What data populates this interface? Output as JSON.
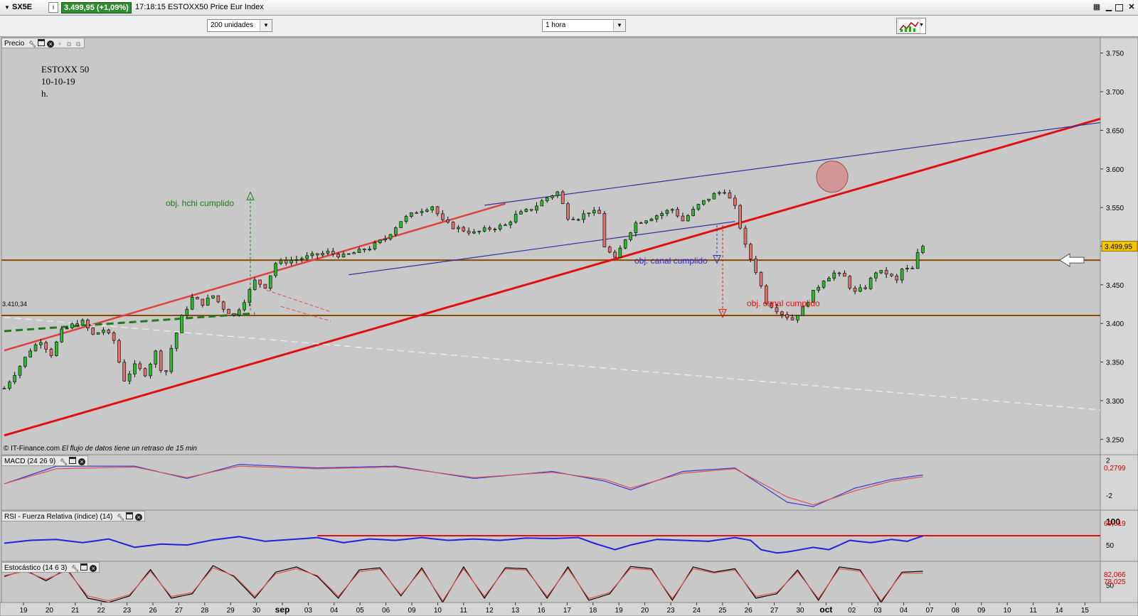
{
  "window": {
    "symbol": "SX5E",
    "info_icon": "info-icon",
    "price_badge": "3.499,95 (+1,09%)",
    "time_title": "17:18:15 ESTOXX50 Price Eur Index"
  },
  "toolbar": {
    "units_select": "200 unidades",
    "interval_select": "1 hora"
  },
  "panels": {
    "price_label": "Precio",
    "macd_label": "MACD (24 26 9)",
    "rsi_label": "RSI - Fuerza Relativa (índice) (14)",
    "stoch_label": "Estocástico (14 6 3)"
  },
  "annotations": {
    "title_line1": "ESTOXX 50",
    "title_line2": "10-10-19",
    "title_line3": "h.",
    "hchi": "obj. hchi cumplido",
    "canal_blue": "obj. canal cumplido",
    "canal_red": "obj. canal cumplido",
    "level_label": "3.410,34",
    "credit_1": "© IT-Finance.com",
    "credit_2": "El flujo de datos tiene un retraso de 15 min"
  },
  "chart_data": [
    {
      "type": "candlestick",
      "title": "",
      "y_ticks": [
        "3.750",
        "3.700",
        "3.650",
        "3.600",
        "3.550",
        "3.500",
        "3.450",
        "3.400",
        "3.350",
        "3.300",
        "3.250"
      ],
      "ylim": [
        3230,
        3770
      ],
      "current_value": "3.499,95",
      "horizontal_levels": [
        3410.34,
        3482
      ],
      "x_ticks": [
        "19",
        "20",
        "21",
        "22",
        "23",
        "26",
        "27",
        "28",
        "29",
        "30",
        "sep",
        "03",
        "04",
        "05",
        "06",
        "09",
        "10",
        "11",
        "12",
        "13",
        "16",
        "17",
        "18",
        "19",
        "20",
        "23",
        "24",
        "25",
        "26",
        "27",
        "30",
        "oct",
        "02",
        "03",
        "04",
        "07",
        "08",
        "09",
        "10",
        "11",
        "14",
        "15"
      ],
      "close_path": [
        [
          0,
          3316
        ],
        [
          3,
          3345
        ],
        [
          5,
          3366
        ],
        [
          7,
          3378
        ],
        [
          9,
          3360
        ],
        [
          11,
          3390
        ],
        [
          13,
          3398
        ],
        [
          15,
          3402
        ],
        [
          17,
          3385
        ],
        [
          19,
          3392
        ],
        [
          21,
          3378
        ],
        [
          22,
          3350
        ],
        [
          23,
          3327
        ],
        [
          25,
          3345
        ],
        [
          27,
          3335
        ],
        [
          29,
          3363
        ],
        [
          30,
          3342
        ],
        [
          31,
          3338
        ],
        [
          32,
          3368
        ],
        [
          34,
          3408
        ],
        [
          36,
          3433
        ],
        [
          38,
          3426
        ],
        [
          40,
          3436
        ],
        [
          42,
          3420
        ],
        [
          44,
          3410
        ],
        [
          46,
          3430
        ],
        [
          48,
          3455
        ],
        [
          50,
          3448
        ],
        [
          52,
          3478
        ],
        [
          56,
          3483
        ],
        [
          62,
          3492
        ],
        [
          65,
          3487
        ],
        [
          70,
          3498
        ],
        [
          73,
          3510
        ],
        [
          76,
          3533
        ],
        [
          79,
          3545
        ],
        [
          82,
          3552
        ],
        [
          84,
          3532
        ],
        [
          86,
          3525
        ],
        [
          90,
          3517
        ],
        [
          93,
          3523
        ],
        [
          96,
          3527
        ],
        [
          98,
          3540
        ],
        [
          101,
          3548
        ],
        [
          104,
          3563
        ],
        [
          106,
          3570
        ],
        [
          108,
          3538
        ],
        [
          110,
          3537
        ],
        [
          112,
          3545
        ],
        [
          114,
          3542
        ],
        [
          115,
          3500
        ],
        [
          117,
          3483
        ],
        [
          119,
          3510
        ],
        [
          121,
          3530
        ],
        [
          125,
          3540
        ],
        [
          128,
          3548
        ],
        [
          130,
          3533
        ],
        [
          133,
          3553
        ],
        [
          136,
          3567
        ],
        [
          138,
          3572
        ],
        [
          140,
          3550
        ],
        [
          142,
          3500
        ],
        [
          144,
          3468
        ],
        [
          146,
          3428
        ],
        [
          149,
          3413
        ],
        [
          151,
          3405
        ],
        [
          153,
          3420
        ],
        [
          155,
          3440
        ],
        [
          157,
          3457
        ],
        [
          159,
          3465
        ],
        [
          161,
          3460
        ],
        [
          162,
          3448
        ],
        [
          163,
          3440
        ],
        [
          165,
          3447
        ],
        [
          167,
          3467
        ],
        [
          169,
          3465
        ],
        [
          171,
          3455
        ],
        [
          172,
          3470
        ],
        [
          174,
          3470
        ],
        [
          175,
          3490
        ],
        [
          176,
          3500
        ]
      ]
    },
    {
      "type": "line",
      "title": "",
      "y_ticks": [
        "2",
        "-2"
      ],
      "ylim": [
        -3.7,
        2.6
      ],
      "current_value": "0,2799",
      "series": [
        {
          "values": [
            [
              0,
              -0.7
            ],
            [
              10,
              1.3
            ],
            [
              25,
              1.3
            ],
            [
              35,
              -0.1
            ],
            [
              45,
              1.5
            ],
            [
              60,
              1.1
            ],
            [
              75,
              1.3
            ],
            [
              90,
              -0.1
            ],
            [
              105,
              0.7
            ],
            [
              115,
              -0.4
            ],
            [
              120,
              -1.4
            ],
            [
              130,
              0.7
            ],
            [
              140,
              1.1
            ],
            [
              150,
              -2.8
            ],
            [
              155,
              -3.3
            ],
            [
              163,
              -1.2
            ],
            [
              170,
              -0.2
            ],
            [
              176,
              0.3
            ]
          ]
        },
        {
          "values": [
            [
              0,
              -0.7
            ],
            [
              10,
              1.0
            ],
            [
              25,
              1.2
            ],
            [
              35,
              0.0
            ],
            [
              45,
              1.3
            ],
            [
              60,
              1.0
            ],
            [
              75,
              1.2
            ],
            [
              90,
              0.0
            ],
            [
              105,
              0.6
            ],
            [
              115,
              -0.2
            ],
            [
              120,
              -1.2
            ],
            [
              130,
              0.5
            ],
            [
              140,
              1.0
            ],
            [
              150,
              -2.2
            ],
            [
              155,
              -3.1
            ],
            [
              163,
              -1.5
            ],
            [
              170,
              -0.4
            ],
            [
              176,
              0.1
            ]
          ]
        }
      ]
    },
    {
      "type": "line",
      "title": "",
      "y_ticks": [
        "100",
        "50"
      ],
      "ylim": [
        15,
        125
      ],
      "current_value": "69,619",
      "levels": [
        70,
        100
      ],
      "series": [
        {
          "values": [
            [
              0,
              54
            ],
            [
              5,
              60
            ],
            [
              10,
              62
            ],
            [
              15,
              55
            ],
            [
              20,
              63
            ],
            [
              25,
              45
            ],
            [
              30,
              52
            ],
            [
              35,
              50
            ],
            [
              40,
              61
            ],
            [
              45,
              68
            ],
            [
              50,
              58
            ],
            [
              55,
              62
            ],
            [
              60,
              66
            ],
            [
              65,
              55
            ],
            [
              70,
              63
            ],
            [
              75,
              60
            ],
            [
              80,
              66
            ],
            [
              85,
              60
            ],
            [
              90,
              63
            ],
            [
              95,
              60
            ],
            [
              100,
              65
            ],
            [
              105,
              64
            ],
            [
              110,
              66
            ],
            [
              113,
              54
            ],
            [
              117,
              40
            ],
            [
              120,
              50
            ],
            [
              125,
              62
            ],
            [
              130,
              60
            ],
            [
              135,
              58
            ],
            [
              140,
              66
            ],
            [
              143,
              60
            ],
            [
              145,
              40
            ],
            [
              148,
              33
            ],
            [
              150,
              35
            ],
            [
              155,
              45
            ],
            [
              158,
              40
            ],
            [
              162,
              60
            ],
            [
              166,
              55
            ],
            [
              170,
              62
            ],
            [
              173,
              58
            ],
            [
              176,
              69.6
            ]
          ]
        }
      ]
    },
    {
      "type": "line",
      "title": "",
      "y_ticks": [
        "50"
      ],
      "ylim": [
        10,
        105
      ],
      "current_value": "82,066",
      "current_value_2": "78,025",
      "series": [
        {
          "values": [
            [
              0,
              70
            ],
            [
              4,
              85
            ],
            [
              8,
              60
            ],
            [
              12,
              88
            ],
            [
              16,
              20
            ],
            [
              20,
              10
            ],
            [
              24,
              25
            ],
            [
              28,
              86
            ],
            [
              32,
              20
            ],
            [
              36,
              30
            ],
            [
              40,
              95
            ],
            [
              44,
              70
            ],
            [
              48,
              20
            ],
            [
              52,
              80
            ],
            [
              56,
              92
            ],
            [
              60,
              70
            ],
            [
              64,
              20
            ],
            [
              68,
              85
            ],
            [
              72,
              90
            ],
            [
              76,
              25
            ],
            [
              80,
              90
            ],
            [
              84,
              10
            ],
            [
              88,
              92
            ],
            [
              92,
              20
            ],
            [
              96,
              90
            ],
            [
              100,
              88
            ],
            [
              104,
              20
            ],
            [
              108,
              92
            ],
            [
              112,
              15
            ],
            [
              116,
              30
            ],
            [
              120,
              93
            ],
            [
              124,
              88
            ],
            [
              128,
              15
            ],
            [
              132,
              92
            ],
            [
              136,
              80
            ],
            [
              140,
              88
            ],
            [
              144,
              20
            ],
            [
              148,
              30
            ],
            [
              152,
              85
            ],
            [
              156,
              15
            ],
            [
              160,
              92
            ],
            [
              164,
              85
            ],
            [
              168,
              10
            ],
            [
              172,
              80
            ],
            [
              176,
              82
            ]
          ]
        },
        {
          "values": [
            [
              0,
              72
            ],
            [
              4,
              82
            ],
            [
              8,
              63
            ],
            [
              12,
              84
            ],
            [
              16,
              25
            ],
            [
              20,
              14
            ],
            [
              24,
              28
            ],
            [
              28,
              82
            ],
            [
              32,
              24
            ],
            [
              36,
              33
            ],
            [
              40,
              90
            ],
            [
              44,
              72
            ],
            [
              48,
              24
            ],
            [
              52,
              76
            ],
            [
              56,
              88
            ],
            [
              60,
              72
            ],
            [
              64,
              24
            ],
            [
              68,
              81
            ],
            [
              72,
              87
            ],
            [
              76,
              28
            ],
            [
              80,
              86
            ],
            [
              84,
              14
            ],
            [
              88,
              88
            ],
            [
              92,
              24
            ],
            [
              96,
              87
            ],
            [
              100,
              85
            ],
            [
              104,
              24
            ],
            [
              108,
              88
            ],
            [
              112,
              19
            ],
            [
              116,
              33
            ],
            [
              120,
              89
            ],
            [
              124,
              85
            ],
            [
              128,
              19
            ],
            [
              132,
              88
            ],
            [
              136,
              78
            ],
            [
              140,
              85
            ],
            [
              144,
              24
            ],
            [
              148,
              33
            ],
            [
              152,
              81
            ],
            [
              156,
              19
            ],
            [
              160,
              88
            ],
            [
              164,
              82
            ],
            [
              168,
              14
            ],
            [
              172,
              77
            ],
            [
              176,
              78
            ]
          ]
        }
      ]
    }
  ]
}
